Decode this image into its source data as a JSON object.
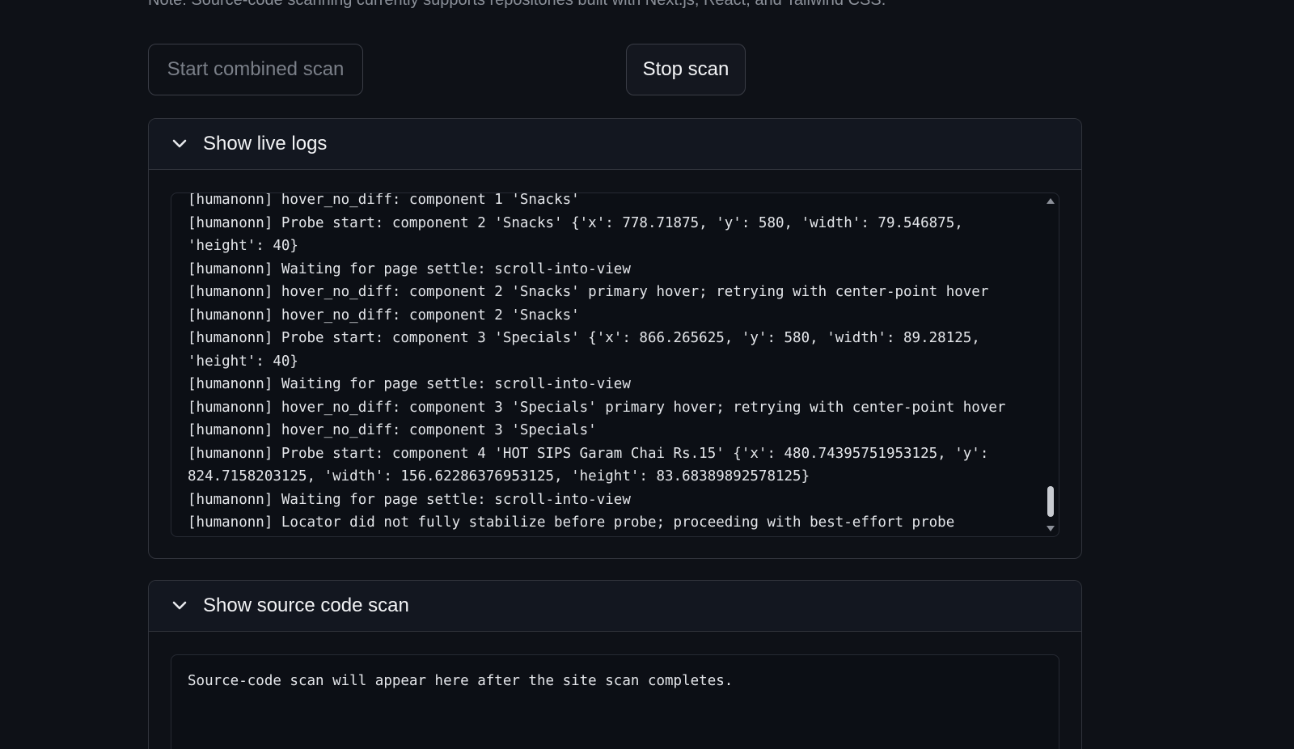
{
  "note": "Note: Source-code scanning currently supports repositories built with Next.js, React, and Tailwind CSS.",
  "buttons": {
    "start_label": "Start combined scan",
    "stop_label": "Stop scan"
  },
  "live_logs": {
    "title": "Show live logs",
    "lines": [
      "[humanonn] hover_no_diff: component 1 'Snacks'",
      "[humanonn] Probe start: component 2 'Snacks' {'x': 778.71875, 'y': 580, 'width': 79.546875,",
      "'height': 40}",
      "[humanonn] Waiting for page settle: scroll-into-view",
      "[humanonn] hover_no_diff: component 2 'Snacks' primary hover; retrying with center-point hover",
      "[humanonn] hover_no_diff: component 2 'Snacks'",
      "[humanonn] Probe start: component 3 'Specials' {'x': 866.265625, 'y': 580, 'width': 89.28125,",
      "'height': 40}",
      "[humanonn] Waiting for page settle: scroll-into-view",
      "[humanonn] hover_no_diff: component 3 'Specials' primary hover; retrying with center-point hover",
      "[humanonn] hover_no_diff: component 3 'Specials'",
      "[humanonn] Probe start: component 4 'HOT SIPS Garam Chai Rs.15' {'x': 480.74395751953125, 'y':",
      "824.7158203125, 'width': 156.62286376953125, 'height': 83.68389892578125}",
      "[humanonn] Waiting for page settle: scroll-into-view",
      "[humanonn] Locator did not fully stabilize before probe; proceeding with best-effort probe"
    ]
  },
  "source_scan": {
    "title": "Show source code scan",
    "placeholder": "Source-code scan will appear here after the site scan completes."
  },
  "icons": {
    "expander_toggle": "chevron-down-icon",
    "scroll_up": "scroll-up-arrow-icon",
    "scroll_down": "scroll-down-arrow-icon"
  },
  "colors": {
    "background": "#0e1117",
    "border": "#31343c",
    "text": "#e6e8ec",
    "muted": "#8b9099"
  }
}
